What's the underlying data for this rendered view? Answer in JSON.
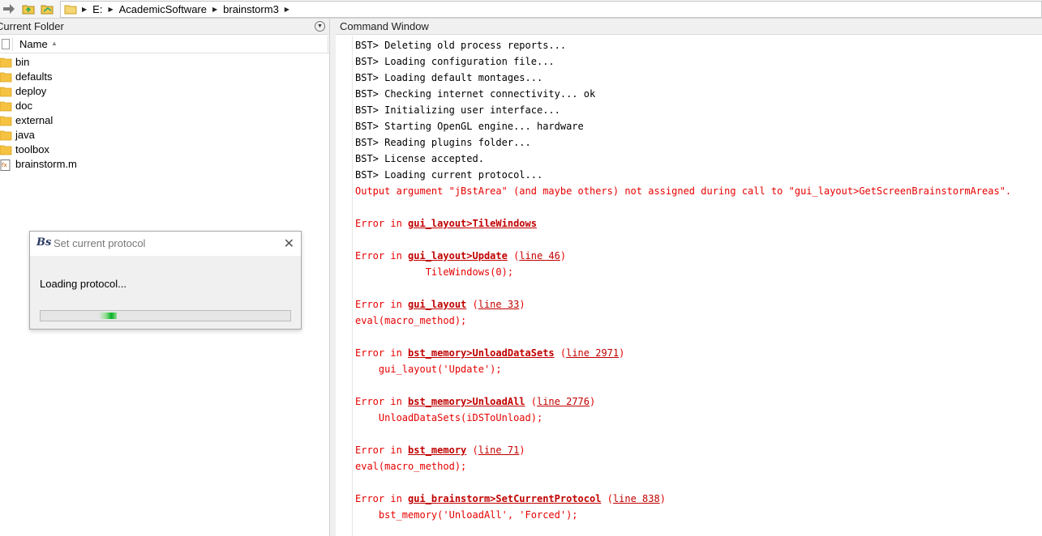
{
  "toolbar": {
    "icons": [
      "forward-arrow-icon",
      "up-folder-icon",
      "browse-folder-icon"
    ]
  },
  "address": {
    "segments": [
      "E:",
      "AcademicSoftware",
      "brainstorm3"
    ]
  },
  "left_panel": {
    "title": "Current Folder",
    "column_name": "Name"
  },
  "files": [
    {
      "name": "bin",
      "type": "folder"
    },
    {
      "name": "defaults",
      "type": "folder"
    },
    {
      "name": "deploy",
      "type": "folder"
    },
    {
      "name": "doc",
      "type": "folder"
    },
    {
      "name": "external",
      "type": "folder"
    },
    {
      "name": "java",
      "type": "folder"
    },
    {
      "name": "toolbox",
      "type": "folder"
    },
    {
      "name": "brainstorm.m",
      "type": "m-file"
    }
  ],
  "command_window": {
    "title": "Command Window",
    "lines": [
      {
        "kind": "plain",
        "text": "BST> Deleting old process reports..."
      },
      {
        "kind": "plain",
        "text": "BST> Loading configuration file..."
      },
      {
        "kind": "plain",
        "text": "BST> Loading default montages..."
      },
      {
        "kind": "plain",
        "text": "BST> Checking internet connectivity... ok"
      },
      {
        "kind": "plain",
        "text": "BST> Initializing user interface..."
      },
      {
        "kind": "plain",
        "text": "BST> Starting OpenGL engine... hardware"
      },
      {
        "kind": "plain",
        "text": "BST> Reading plugins folder..."
      },
      {
        "kind": "plain",
        "text": "BST> License accepted."
      },
      {
        "kind": "plain",
        "text": "BST> Loading current protocol..."
      },
      {
        "kind": "err",
        "text": "Output argument \"jBstArea\" (and maybe others) not assigned during call to \"gui_layout>GetScreenBrainstormAreas\"."
      },
      {
        "kind": "blank",
        "text": ""
      },
      {
        "kind": "errlink",
        "prefix": "Error in ",
        "link": "gui_layout>TileWindows",
        "line": ""
      },
      {
        "kind": "blank",
        "text": ""
      },
      {
        "kind": "errlink",
        "prefix": "Error in ",
        "link": "gui_layout>Update",
        "line": "line 46"
      },
      {
        "kind": "err",
        "text": "            TileWindows(0);"
      },
      {
        "kind": "blank",
        "text": ""
      },
      {
        "kind": "errlink",
        "prefix": "Error in ",
        "link": "gui_layout",
        "line": "line 33"
      },
      {
        "kind": "err",
        "text": "eval(macro_method);"
      },
      {
        "kind": "blank",
        "text": ""
      },
      {
        "kind": "errlink",
        "prefix": "Error in ",
        "link": "bst_memory>UnloadDataSets",
        "line": "line 2971"
      },
      {
        "kind": "err",
        "text": "    gui_layout('Update');"
      },
      {
        "kind": "blank",
        "text": ""
      },
      {
        "kind": "errlink",
        "prefix": "Error in ",
        "link": "bst_memory>UnloadAll",
        "line": "line 2776"
      },
      {
        "kind": "err",
        "text": "    UnloadDataSets(iDSToUnload);"
      },
      {
        "kind": "blank",
        "text": ""
      },
      {
        "kind": "errlink",
        "prefix": "Error in ",
        "link": "bst_memory",
        "line": "line 71"
      },
      {
        "kind": "err",
        "text": "eval(macro_method);"
      },
      {
        "kind": "blank",
        "text": ""
      },
      {
        "kind": "errlink",
        "prefix": "Error in ",
        "link": "gui_brainstorm>SetCurrentProtocol",
        "line": "line 838"
      },
      {
        "kind": "err",
        "text": "    bst_memory('UnloadAll', 'Forced');"
      }
    ]
  },
  "dialog": {
    "logo": "Bs",
    "title": "Set current protocol",
    "message": "Loading protocol...",
    "progress_state": "indeterminate"
  },
  "colors": {
    "error_text": "#e60000",
    "error_link": "#c00000",
    "progress_green": "#06b025",
    "folder_yellow": "#f5c242"
  }
}
